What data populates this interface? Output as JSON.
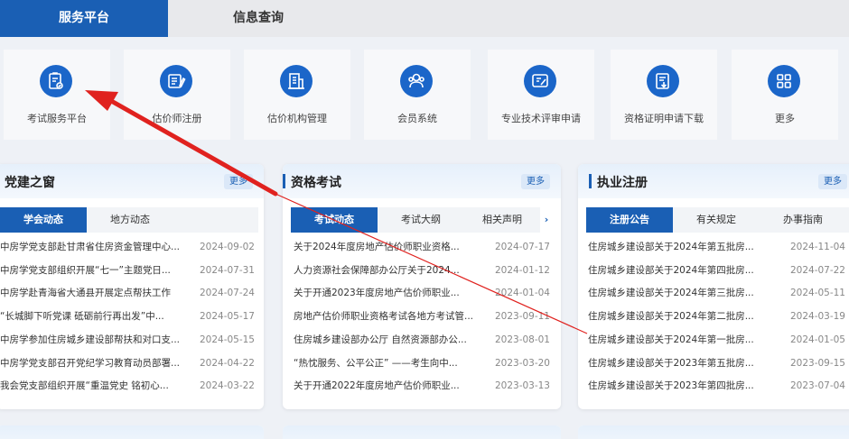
{
  "tabs": {
    "service_platform": "服务平台",
    "info_query": "信息查询"
  },
  "services": [
    {
      "label": "考试服务平台",
      "icon": "exam-clipboard-icon"
    },
    {
      "label": "估价师注册",
      "icon": "register-book-icon"
    },
    {
      "label": "估价机构管理",
      "icon": "building-icon"
    },
    {
      "label": "会员系统",
      "icon": "members-icon"
    },
    {
      "label": "专业技术评审申请",
      "icon": "review-certificate-icon"
    },
    {
      "label": "资格证明申请下载",
      "icon": "download-document-icon"
    },
    {
      "label": "更多",
      "icon": "grid-more-icon"
    }
  ],
  "cards": {
    "party": {
      "title": "党建之窗",
      "more": "更多",
      "tabs": [
        "学会动态",
        "地方动态"
      ],
      "rows": [
        {
          "text": "中房学党支部赴甘肃省住房资金管理中心...",
          "date": "2024-09-02"
        },
        {
          "text": "中房学党支部组织开展“七一”主题党日...",
          "date": "2024-07-31"
        },
        {
          "text": "中房学赴青海省大通县开展定点帮扶工作",
          "date": "2024-07-24"
        },
        {
          "text": "“长城脚下听党课 砥砺前行再出发”中...",
          "date": "2024-05-17"
        },
        {
          "text": "中房学参加住房城乡建设部帮扶和对口支...",
          "date": "2024-05-15"
        },
        {
          "text": "中房学党支部召开党纪学习教育动员部署...",
          "date": "2024-04-22"
        },
        {
          "text": "我会党支部组织开展“重温党史 铭初心...",
          "date": "2024-03-22"
        }
      ]
    },
    "exam": {
      "title": "资格考试",
      "more": "更多",
      "tabs": [
        "考试动态",
        "考试大纲",
        "相关声明"
      ],
      "rows": [
        {
          "text": "关于2024年度房地产估价师职业资格...",
          "date": "2024-07-17"
        },
        {
          "text": "人力资源社会保障部办公厅关于2024...",
          "date": "2024-01-12"
        },
        {
          "text": "关于开通2023年度房地产估价师职业...",
          "date": "2024-01-04"
        },
        {
          "text": "房地产估价师职业资格考试各地方考试管...",
          "date": "2023-09-11"
        },
        {
          "text": "住房城乡建设部办公厅 自然资源部办公...",
          "date": "2023-08-01"
        },
        {
          "text": "“热忱服务、公平公正” ——考生向中...",
          "date": "2023-03-20"
        },
        {
          "text": "关于开通2022年度房地产估价师职业...",
          "date": "2023-03-13"
        }
      ]
    },
    "reg": {
      "title": "执业注册",
      "more": "更多",
      "tabs": [
        "注册公告",
        "有关规定",
        "办事指南"
      ],
      "rows": [
        {
          "text": "住房城乡建设部关于2024年第五批房...",
          "date": "2024-11-04"
        },
        {
          "text": "住房城乡建设部关于2024年第四批房...",
          "date": "2024-07-22"
        },
        {
          "text": "住房城乡建设部关于2024年第三批房...",
          "date": "2024-05-11"
        },
        {
          "text": "住房城乡建设部关于2024年第二批房...",
          "date": "2024-03-19"
        },
        {
          "text": "住房城乡建设部关于2024年第一批房...",
          "date": "2024-01-05"
        },
        {
          "text": "住房城乡建设部关于2023年第五批房...",
          "date": "2023-09-15"
        },
        {
          "text": "住房城乡建设部关于2023年第四批房...",
          "date": "2023-07-04"
        }
      ]
    }
  },
  "colors": {
    "brand": "#1a5fb4",
    "arrow": "#e0221f"
  }
}
